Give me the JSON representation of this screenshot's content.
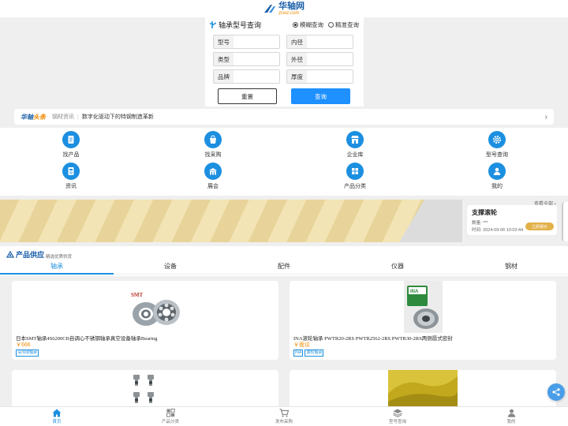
{
  "header": {
    "logo_cn": "华轴网",
    "logo_en": "zcwz.com"
  },
  "search": {
    "title": "轴承型号查询",
    "modes": [
      {
        "label": "模糊查询",
        "selected": true
      },
      {
        "label": "精准查询",
        "selected": false
      }
    ],
    "fields": [
      {
        "label": "型号",
        "value": ""
      },
      {
        "label": "内径",
        "value": ""
      },
      {
        "label": "类型",
        "value": ""
      },
      {
        "label": "外径",
        "value": ""
      },
      {
        "label": "品牌",
        "value": ""
      },
      {
        "label": "厚度",
        "value": ""
      }
    ],
    "reset_label": "重置",
    "query_label": "查询"
  },
  "news": {
    "brand": "华轴",
    "brand_accent": "头条",
    "category": "钢材资讯",
    "headline": "数字化驱动下的特钢制造革新"
  },
  "nav": [
    {
      "label": "找产品",
      "icon": "document-icon"
    },
    {
      "label": "找采购",
      "icon": "bag-icon"
    },
    {
      "label": "企业库",
      "icon": "store-icon"
    },
    {
      "label": "型号查询",
      "icon": "gear-icon"
    },
    {
      "label": "资讯",
      "icon": "news-icon"
    },
    {
      "label": "展会",
      "icon": "building-icon"
    },
    {
      "label": "产品分类",
      "icon": "grid-icon"
    },
    {
      "label": "我的",
      "icon": "user-icon"
    }
  ],
  "promo": {
    "view_all": "查看全部",
    "title": "支撑滚轮",
    "qty_label": "数量:",
    "qty_value": "***",
    "time_label": "时间:",
    "time_value": "2024-09-06 10:03:44",
    "button": "立即报价"
  },
  "supply": {
    "title": "产品供应",
    "subtitle": "精选优质供货"
  },
  "tabs": [
    "轴承",
    "设备",
    "配件",
    "仪器",
    "钢材"
  ],
  "active_tab": 0,
  "products": [
    {
      "name": "日本SMT轴承4S6200CB自调心不锈钢轴承真空设备轴承Bearing",
      "price": "￥666",
      "tags": [
        "深沟球轴承"
      ],
      "brand_mark": "SMT"
    },
    {
      "name": "INA滚轮轴承 PWTR20-2RS PWTR2562-2RS PWTR30-2RS两侧唇式密封",
      "price": "￥面议",
      "tags": [
        "INA",
        "滚轮轴承"
      ],
      "brand_mark": "INA"
    },
    {
      "name": "",
      "price": "",
      "tags": []
    },
    {
      "name": "",
      "price": "",
      "tags": []
    }
  ],
  "bottom_nav": [
    {
      "label": "首页",
      "icon": "home-icon",
      "active": true
    },
    {
      "label": "产品分类",
      "icon": "category-icon",
      "active": false
    },
    {
      "label": "发布采购",
      "icon": "cart-icon",
      "active": false
    },
    {
      "label": "型号查询",
      "icon": "layers-icon",
      "active": false
    },
    {
      "label": "我的",
      "icon": "user-icon",
      "active": false
    }
  ],
  "colors": {
    "primary": "#1c8fe0",
    "brand": "#1a5fa8",
    "accent": "#f08a00",
    "banner": "#e8d49a"
  }
}
